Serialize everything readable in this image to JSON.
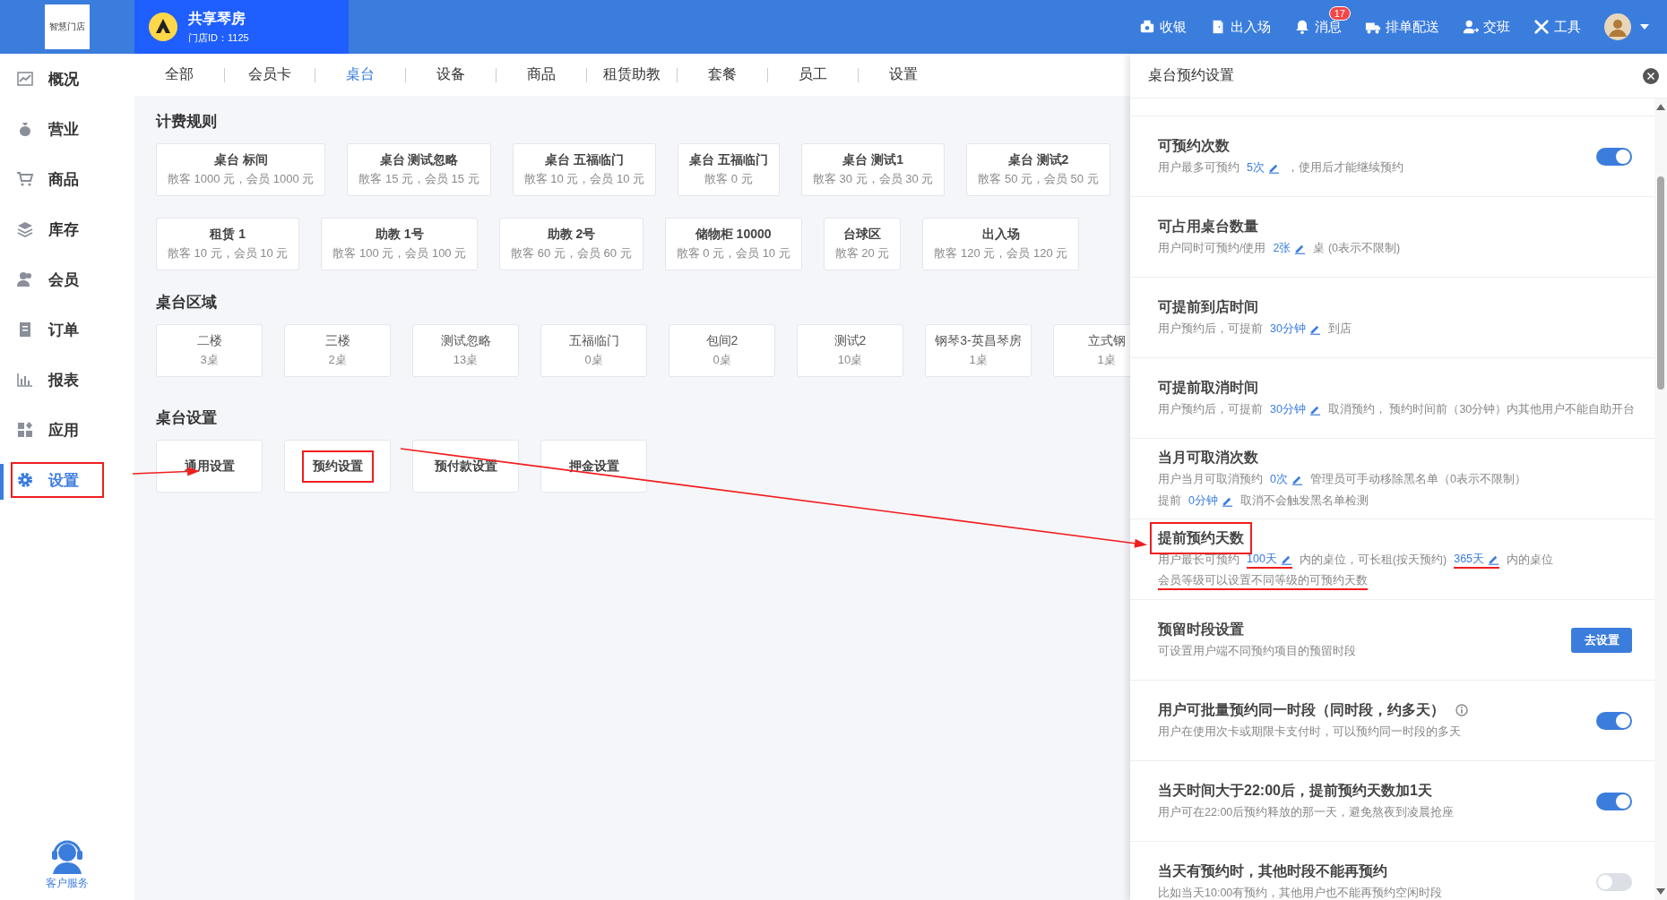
{
  "brand": {
    "logo_text": "智慧门店"
  },
  "store": {
    "name": "共享琴房",
    "id_label": "门店ID：1125"
  },
  "top_actions": [
    {
      "label": "收银"
    },
    {
      "label": "出入场"
    },
    {
      "label": "消息",
      "badge": "17"
    },
    {
      "label": "排单配送"
    },
    {
      "label": "交班"
    },
    {
      "label": "工具"
    }
  ],
  "sidebar": {
    "items": [
      {
        "label": "概况",
        "selected": false,
        "highlighted": false
      },
      {
        "label": "营业",
        "selected": false,
        "highlighted": false
      },
      {
        "label": "商品",
        "selected": false,
        "highlighted": false
      },
      {
        "label": "库存",
        "selected": false,
        "highlighted": false
      },
      {
        "label": "会员",
        "selected": false,
        "highlighted": false
      },
      {
        "label": "订单",
        "selected": false,
        "highlighted": false
      },
      {
        "label": "报表",
        "selected": false,
        "highlighted": false
      },
      {
        "label": "应用",
        "selected": false,
        "highlighted": false
      },
      {
        "label": "设置",
        "selected": true,
        "highlighted": true
      }
    ],
    "support": "客户服务"
  },
  "tabs": [
    {
      "label": "全部",
      "selected": false
    },
    {
      "label": "会员卡",
      "selected": false
    },
    {
      "label": "桌台",
      "selected": true
    },
    {
      "label": "设备",
      "selected": false
    },
    {
      "label": "商品",
      "selected": false
    },
    {
      "label": "租赁助教",
      "selected": false
    },
    {
      "label": "套餐",
      "selected": false
    },
    {
      "label": "员工",
      "selected": false
    },
    {
      "label": "设置",
      "selected": false
    }
  ],
  "billing_rules": {
    "title": "计费规则",
    "rows": [
      [
        {
          "name": "桌台 标间",
          "price": "散客 1000 元，会员 1000 元"
        },
        {
          "name": "桌台 测试忽略",
          "price": "散客 15 元，会员 15 元"
        },
        {
          "name": "桌台 五福临门",
          "price": "散客 10 元，会员 10 元"
        },
        {
          "name": "桌台 五福临门",
          "price": "散客 0 元"
        },
        {
          "name": "桌台 测试1",
          "price": "散客 30 元，会员 30 元"
        },
        {
          "name": "桌台 测试2",
          "price": "散客 50 元，会员 50 元"
        }
      ],
      [
        {
          "name": "租赁 1",
          "price": "散客 10 元，会员 10 元"
        },
        {
          "name": "助教 1号",
          "price": "散客 100 元，会员 100 元"
        },
        {
          "name": "助教 2号",
          "price": "散客 60 元，会员 60 元"
        },
        {
          "name": "储物柜 10000",
          "price": "散客 0 元，会员 10 元"
        },
        {
          "name": "台球区",
          "price": "散客 20 元"
        },
        {
          "name": "出入场",
          "price": "散客 120 元，会员 120 元"
        }
      ]
    ]
  },
  "areas": {
    "title": "桌台区域",
    "items": [
      {
        "name": "二楼",
        "count": "3桌"
      },
      {
        "name": "三楼",
        "count": "2桌"
      },
      {
        "name": "测试忽略",
        "count": "13桌"
      },
      {
        "name": "五福临门",
        "count": "0桌"
      },
      {
        "name": "包间2",
        "count": "0桌"
      },
      {
        "name": "测试2",
        "count": "10桌"
      },
      {
        "name": "钢琴3-英昌琴房",
        "count": "1桌"
      },
      {
        "name": "立式钢",
        "count": "1桌"
      }
    ]
  },
  "table_settings": {
    "title": "桌台设置",
    "items": [
      {
        "label": "通用设置",
        "highlighted": false
      },
      {
        "label": "预约设置",
        "highlighted": true
      },
      {
        "label": "预付款设置",
        "highlighted": false
      },
      {
        "label": "押金设置",
        "highlighted": false
      }
    ]
  },
  "panel": {
    "title": "桌台预约设置",
    "rows": [
      {
        "kind": "toggle",
        "title": "可预约次数",
        "highlighted": false,
        "on": true,
        "lines": [
          [
            {
              "kind": "text",
              "text": "用户最多可预约"
            },
            {
              "kind": "value",
              "text": "5次"
            },
            {
              "kind": "text",
              "text": "，使用后才能继续预约"
            }
          ]
        ]
      },
      {
        "kind": "plain",
        "title": "可占用桌台数量",
        "highlighted": false,
        "lines": [
          [
            {
              "kind": "text",
              "text": "用户同时可预约/使用"
            },
            {
              "kind": "value",
              "text": "2张"
            },
            {
              "kind": "text",
              "text": "桌 (0表示不限制)"
            }
          ]
        ]
      },
      {
        "kind": "plain",
        "title": "可提前到店时间",
        "highlighted": false,
        "lines": [
          [
            {
              "kind": "text",
              "text": "用户预约后，可提前"
            },
            {
              "kind": "value",
              "text": "30分钟"
            },
            {
              "kind": "text",
              "text": "到店"
            }
          ]
        ]
      },
      {
        "kind": "plain",
        "title": "可提前取消时间",
        "highlighted": false,
        "lines": [
          [
            {
              "kind": "text",
              "text": "用户预约后，可提前"
            },
            {
              "kind": "value",
              "text": "30分钟"
            },
            {
              "kind": "text",
              "text": "取消预约， 预约时间前（30分钟）内其他用户不能自助开台"
            }
          ]
        ]
      },
      {
        "kind": "plain",
        "title": "当月可取消次数",
        "highlighted": false,
        "lines": [
          [
            {
              "kind": "text",
              "text": "用户当月可取消预约"
            },
            {
              "kind": "value",
              "text": "0次"
            },
            {
              "kind": "text",
              "text": "管理员可手动移除黑名单（0表示不限制）"
            }
          ],
          [
            {
              "kind": "text",
              "text": "提前"
            },
            {
              "kind": "value",
              "text": "0分钟"
            },
            {
              "kind": "text",
              "text": "取消不会触发黑名单检测"
            }
          ]
        ]
      },
      {
        "kind": "plain",
        "title": "提前预约天数",
        "highlighted": true,
        "lines": [
          [
            {
              "kind": "text",
              "text": "用户最长可预约",
              "underlined": false
            },
            {
              "kind": "value",
              "text": "100天",
              "underlined": true
            },
            {
              "kind": "text",
              "text": "内的桌位，可长租(按天预约)",
              "underlined": false
            },
            {
              "kind": "value",
              "text": "365天",
              "underlined": true
            },
            {
              "kind": "text",
              "text": "内的桌位",
              "underlined": false
            }
          ],
          [
            {
              "kind": "text",
              "text": "会员等级可以设置不同等级的可预约天数",
              "underlined": true
            }
          ]
        ]
      },
      {
        "kind": "button",
        "title": "预留时段设置",
        "highlighted": false,
        "button": "去设置",
        "lines": [
          [
            {
              "kind": "text",
              "text": "可设置用户端不同预约项目的预留时段"
            }
          ]
        ]
      },
      {
        "kind": "toggle",
        "title": "用户可批量预约同一时段（同时段，约多天）",
        "info": true,
        "highlighted": false,
        "on": true,
        "lines": [
          [
            {
              "kind": "text",
              "text": "用户在使用次卡或期限卡支付时，可以预约同一时段的多天"
            }
          ]
        ]
      },
      {
        "kind": "toggle",
        "title": "当天时间大于22:00后，提前预约天数加1天",
        "highlighted": false,
        "on": true,
        "lines": [
          [
            {
              "kind": "text",
              "text": "用户可在22:00后预约释放的那一天，避免熬夜到凌晨抢座"
            }
          ]
        ]
      },
      {
        "kind": "toggle",
        "title": "当天有预约时，其他时段不能再预约",
        "highlighted": false,
        "on": false,
        "lines": [
          [
            {
              "kind": "text",
              "text": "比如当天10:00有预约，其他用户也不能再预约空闲时段"
            }
          ]
        ]
      }
    ]
  }
}
